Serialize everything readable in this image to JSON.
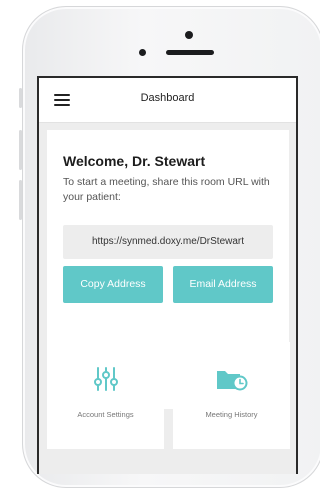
{
  "header": {
    "title": "Dashboard",
    "menu_icon": "hamburger-menu-icon"
  },
  "welcome": {
    "heading": "Welcome, Dr. Stewart",
    "description": "To start a meeting, share this room URL with your patient:",
    "room_url": "https://synmed.doxy.me/DrStewart"
  },
  "actions": {
    "copy_label": "Copy Address",
    "email_label": "Email Address"
  },
  "tiles": [
    {
      "label": "Account Settings",
      "icon": "sliders-icon"
    },
    {
      "label": "Meeting History",
      "icon": "folder-clock-icon"
    }
  ],
  "colors": {
    "accent": "#60c8c8",
    "background": "#ededed"
  }
}
